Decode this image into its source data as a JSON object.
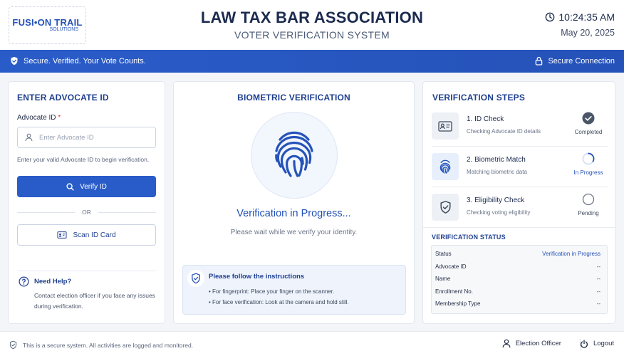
{
  "header": {
    "logo_text": "FUSI•ON TRAIL",
    "logo_sub": "SOLUTIONS",
    "title": "LAW TAX BAR ASSOCIATION",
    "subtitle": "VOTER VERIFICATION SYSTEM",
    "time": "10:24:35 AM",
    "date": "May 20, 2025"
  },
  "banner": {
    "left_text": "Secure. Verified. Your Vote Counts.",
    "right_text": "Secure Connection"
  },
  "left_panel": {
    "title": "ENTER ADVOCATE ID",
    "field_label": "Advocate ID",
    "required_mark": "*",
    "input_placeholder": "Enter Advocate ID",
    "input_value": "",
    "helper_text": "Enter your valid Advocate ID to begin verification.",
    "verify_button": "Verify ID",
    "or_text": "OR",
    "scan_button": "Scan ID Card",
    "help_title": "Need Help?",
    "help_text": "Contact election officer if you face any issues during verification."
  },
  "center_panel": {
    "title": "BIOMETRIC VERIFICATION",
    "status_title": "Verification in Progress...",
    "status_sub": "Please wait while we verify your identity.",
    "instructions_title": "Please follow the instructions",
    "instructions": [
      "For fingerprint: Place your finger on the scanner.",
      "For face verification: Look at the camera and hold still."
    ]
  },
  "right_panel": {
    "title": "VERIFICATION STEPS",
    "steps": [
      {
        "title": "1. ID Check",
        "desc": "Checking Advocate ID details",
        "status": "Completed",
        "icon": "id-card-icon"
      },
      {
        "title": "2. Biometric Match",
        "desc": "Matching biometric data",
        "status": "In Progress",
        "icon": "fingerprint-icon"
      },
      {
        "title": "3. Eligibility Check",
        "desc": "Checking voting eligibility",
        "status": "Pending",
        "icon": "shield-check-icon"
      }
    ],
    "status_title": "VERIFICATION STATUS",
    "status_rows": [
      {
        "key": "Status",
        "value": "Verification in Progress"
      },
      {
        "key": "Advocate ID",
        "value": "--"
      },
      {
        "key": "Name",
        "value": "--"
      },
      {
        "key": "Enrollment No.",
        "value": "--"
      },
      {
        "key": "Membership Type",
        "value": "--"
      }
    ]
  },
  "footer": {
    "notice": "This is a secure system. All activities are logged and monitored.",
    "officer_label": "Election Officer",
    "logout_label": "Logout"
  },
  "colors": {
    "primary": "#2a5cc9",
    "title_navy": "#1b2a4e",
    "completed": "#4a5568",
    "background": "#f3f5f9"
  }
}
